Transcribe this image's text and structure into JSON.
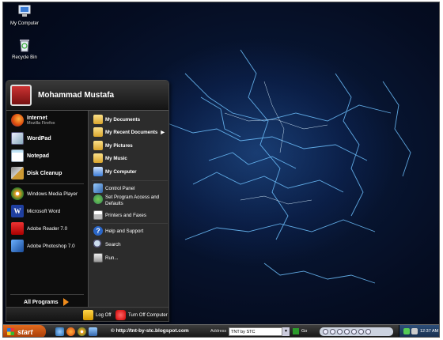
{
  "desktop": {
    "icons": [
      {
        "label": "My Computer",
        "icon": "my-computer-icon"
      },
      {
        "label": "Recycle Bin",
        "icon": "recycle-bin-icon"
      }
    ]
  },
  "start_menu": {
    "user_name": "Mohammad Mustafa",
    "pinned": [
      {
        "label": "Internet",
        "sublabel": "Mozilla Firefox",
        "icon": "firefox-icon"
      },
      {
        "label": "WordPad",
        "icon": "wordpad-icon"
      },
      {
        "label": "Notepad",
        "icon": "notepad-icon"
      },
      {
        "label": "Disk Cleanup",
        "icon": "disk-cleanup-icon"
      }
    ],
    "recent": [
      {
        "label": "Windows Media Player",
        "icon": "media-player-icon"
      },
      {
        "label": "Microsoft Word",
        "icon": "word-icon"
      },
      {
        "label": "Adobe Reader 7.0",
        "icon": "adobe-reader-icon"
      },
      {
        "label": "Adobe Photoshop 7.0",
        "icon": "photoshop-icon"
      }
    ],
    "all_programs": "All Programs",
    "places": [
      {
        "label": "My Documents",
        "icon": "folder-icon"
      },
      {
        "label": "My Recent Documents",
        "icon": "recent-documents-icon"
      },
      {
        "label": "My Pictures",
        "icon": "pictures-folder-icon"
      },
      {
        "label": "My Music",
        "icon": "music-folder-icon"
      },
      {
        "label": "My Computer",
        "icon": "computer-icon"
      }
    ],
    "system": [
      {
        "label": "Control Panel",
        "icon": "control-panel-icon"
      },
      {
        "label": "Set Program Access and Defaults",
        "icon": "program-access-icon"
      },
      {
        "label": "Printers and Faxes",
        "icon": "printer-icon"
      }
    ],
    "help": [
      {
        "label": "Help and Support",
        "icon": "help-icon"
      },
      {
        "label": "Search",
        "icon": "search-icon"
      },
      {
        "label": "Run...",
        "icon": "run-icon"
      }
    ],
    "log_off": "Log Off",
    "turn_off": "Turn Off Computer"
  },
  "taskbar": {
    "start_label": "start",
    "url_text": "© http://tnt-by-stc.blogspot.com",
    "address_label": "Address",
    "address_value": "TNT by STC",
    "go_label": "Go",
    "clock": "12:37 AM"
  },
  "colors": {
    "start_button": "#d25a14",
    "all_programs_arrow": "#f08c1c",
    "wallpaper_glow": "#4a9cff"
  }
}
